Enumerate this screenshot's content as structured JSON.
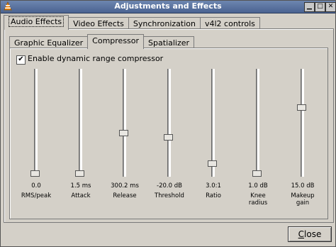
{
  "window": {
    "title": "Adjustments and Effects"
  },
  "main_tabs": [
    {
      "label": "Audio Effects",
      "active": true
    },
    {
      "label": "Video Effects",
      "active": false
    },
    {
      "label": "Synchronization",
      "active": false
    },
    {
      "label": "v4l2 controls",
      "active": false
    }
  ],
  "sub_tabs": [
    {
      "label": "Graphic Equalizer",
      "active": false
    },
    {
      "label": "Compressor",
      "active": true
    },
    {
      "label": "Spatializer",
      "active": false
    }
  ],
  "compressor": {
    "enable_label": "Enable dynamic range compressor",
    "enabled": true
  },
  "sliders": [
    {
      "value": "0.0",
      "label": "RMS/peak",
      "level": 0.0
    },
    {
      "value": "1.5 ms",
      "label": "Attack",
      "level": 0.0
    },
    {
      "value": "300.2 ms",
      "label": "Release",
      "level": 0.4
    },
    {
      "value": "-20.0 dB",
      "label": "Threshold",
      "level": 0.36
    },
    {
      "value": "3.0:1",
      "label": "Ratio",
      "level": 0.1
    },
    {
      "value": "1.0 dB",
      "label": "Knee\nradius",
      "level": 0.0
    },
    {
      "value": "15.0 dB",
      "label": "Makeup\ngain",
      "level": 0.65
    }
  ],
  "close_button": {
    "label": "Close",
    "mnemonic": "C",
    "rest": "lose"
  }
}
